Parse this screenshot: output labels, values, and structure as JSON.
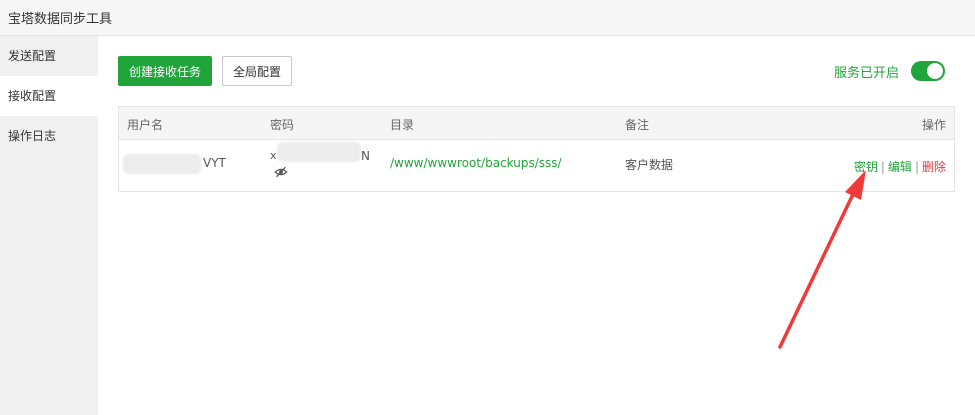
{
  "app": {
    "title": "宝塔数据同步工具"
  },
  "sidebar": {
    "items": [
      {
        "label": "发送配置",
        "active": false
      },
      {
        "label": "接收配置",
        "active": true
      },
      {
        "label": "操作日志",
        "active": false
      }
    ]
  },
  "toolbar": {
    "create_label": "创建接收任务",
    "global_label": "全局配置"
  },
  "service": {
    "label": "服务已开启",
    "enabled": true
  },
  "table": {
    "headers": {
      "username": "用户名",
      "password": "密码",
      "directory": "目录",
      "note": "备注",
      "actions": "操作"
    },
    "rows": [
      {
        "username_suffix": "VYT",
        "password_prefix": "x",
        "password_suffix": "N",
        "directory": "/www/wwwroot/backups/sss/",
        "note": "客户数据",
        "action_key": "密钥",
        "action_edit": "编辑",
        "action_delete": "删除",
        "separator": "|"
      }
    ]
  },
  "colors": {
    "accent": "#20a53a",
    "danger": "#e43b3b",
    "annotation_arrow": "#f03a3a"
  }
}
